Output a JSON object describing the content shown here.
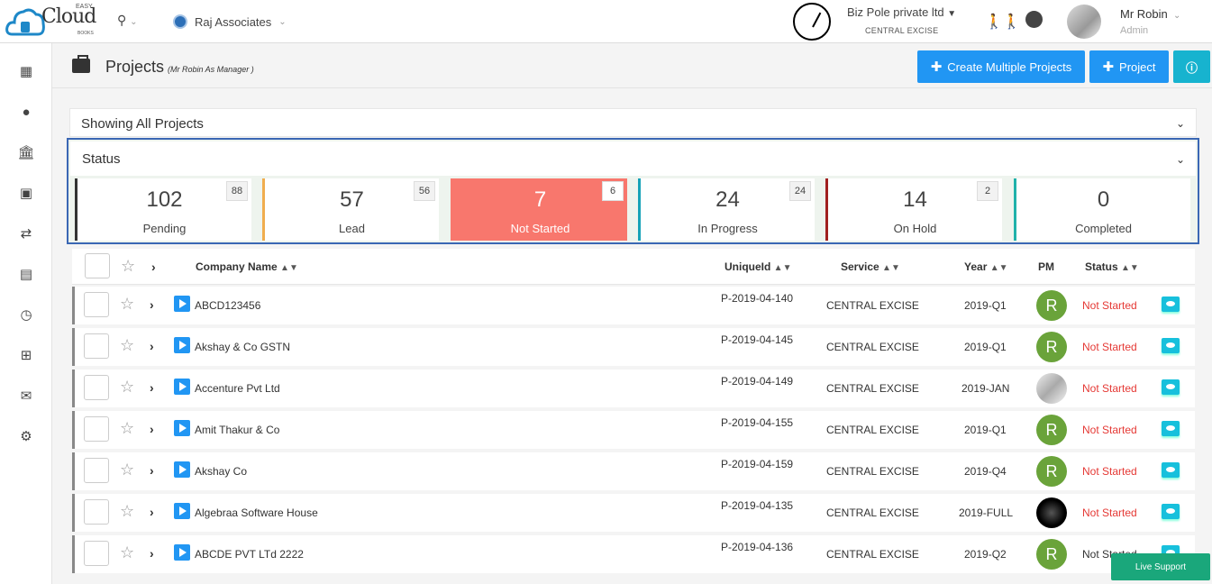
{
  "brand": {
    "logo_text": "Cloud",
    "easy": "EASY",
    "books": "BOOKS"
  },
  "topbar": {
    "organization": "Raj Associates",
    "business": "Biz Pole private ltd",
    "business_sub": "CENTRAL EXCISE",
    "user_name": "Mr Robin",
    "user_role": "Admin"
  },
  "page": {
    "title": "Projects",
    "subtitle": "(Mr Robin As Manager )",
    "create_multiple_label": "Create Multiple Projects",
    "project_label": "Project"
  },
  "panels": {
    "all_projects": "Showing All Projects",
    "status": "Status"
  },
  "status_cards": [
    {
      "count": "102",
      "label": "Pending",
      "badge": "88",
      "color": "#333333"
    },
    {
      "count": "57",
      "label": "Lead",
      "badge": "56",
      "color": "#f0ad4e"
    },
    {
      "count": "7",
      "label": "Not Started",
      "badge": "6",
      "color": "#f8776d"
    },
    {
      "count": "24",
      "label": "In Progress",
      "badge": "24",
      "color": "#17a2b8"
    },
    {
      "count": "14",
      "label": "On Hold",
      "badge": "2",
      "color": "#a02020"
    },
    {
      "count": "0",
      "label": "Completed",
      "badge": "",
      "color": "#20b2aa"
    }
  ],
  "table": {
    "headers": {
      "company": "Company Name",
      "unique_id": "UniqueId",
      "service": "Service",
      "year": "Year",
      "pm": "PM",
      "status": "Status"
    },
    "rows": [
      {
        "company": "ABCD123456",
        "id": "P-2019-04-140",
        "service": "CENTRAL EXCISE",
        "year": "2019-Q1",
        "pm": "R",
        "status": "Not Started"
      },
      {
        "company": "Akshay & Co GSTN",
        "id": "P-2019-04-145",
        "service": "CENTRAL EXCISE",
        "year": "2019-Q1",
        "pm": "R",
        "status": "Not Started"
      },
      {
        "company": "Accenture Pvt Ltd",
        "id": "P-2019-04-149",
        "service": "CENTRAL EXCISE",
        "year": "2019-JAN",
        "pm": "",
        "status": "Not Started"
      },
      {
        "company": "Amit Thakur & Co",
        "id": "P-2019-04-155",
        "service": "CENTRAL EXCISE",
        "year": "2019-Q1",
        "pm": "R",
        "status": "Not Started"
      },
      {
        "company": "Akshay Co",
        "id": "P-2019-04-159",
        "service": "CENTRAL EXCISE",
        "year": "2019-Q4",
        "pm": "R",
        "status": "Not Started"
      },
      {
        "company": "Algebraa Software House",
        "id": "P-2019-04-135",
        "service": "CENTRAL EXCISE",
        "year": "2019-FULL",
        "pm": "",
        "status": "Not Started"
      },
      {
        "company": "ABCDE PVT LTd 2222",
        "id": "P-2019-04-136",
        "service": "CENTRAL EXCISE",
        "year": "2019-Q2",
        "pm": "R",
        "status": "Not Started"
      }
    ]
  },
  "live_support": "Live Support",
  "icons": {
    "sidebar": [
      "dashboard-icon",
      "user-icon",
      "bank-icon",
      "briefcase-icon",
      "transfer-icon",
      "document-icon",
      "clock-icon",
      "plus-square-icon",
      "mail-icon",
      "gear-icon"
    ]
  }
}
